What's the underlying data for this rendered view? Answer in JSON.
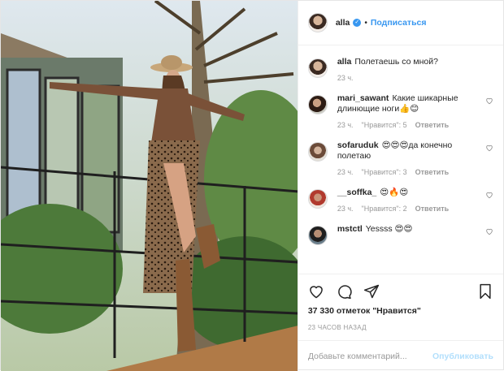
{
  "header": {
    "username": "alla",
    "verified_icon": "verified-check-icon",
    "separator": "•",
    "follow_label": "Подписаться"
  },
  "caption": {
    "username": "alla",
    "text": "Полетаешь со мной?",
    "time": "23 ч."
  },
  "comments": [
    {
      "username": "mari_sawant",
      "text": "Какие шикарные длинющие ноги👍😊",
      "time": "23 ч.",
      "likes": "\"Нравится\": 5",
      "reply": "Ответить"
    },
    {
      "username": "sofaruduk",
      "text": "😍😍😍да конечно полетаю",
      "time": "23 ч.",
      "likes": "\"Нравится\": 3",
      "reply": "Ответить"
    },
    {
      "username": "__soffka_",
      "text": "😍🔥😍",
      "time": "23 ч.",
      "likes": "\"Нравится\": 2",
      "reply": "Ответить"
    },
    {
      "username": "mstctl",
      "text": "Yessss 😍😍",
      "time": "",
      "likes": "",
      "reply": ""
    }
  ],
  "actions": {
    "like_icon": "heart-icon",
    "comment_icon": "comment-icon",
    "share_icon": "share-icon",
    "save_icon": "bookmark-icon"
  },
  "likes_text": "37 330 отметок \"Нравится\"",
  "posted_time": "23 ЧАСОВ НАЗАД",
  "add_comment": {
    "placeholder": "Добавьте комментарий...",
    "publish_label": "Опубликовать"
  },
  "colors": {
    "accent": "#3897f0",
    "publish_disabled": "#b2dffc",
    "muted": "#999999",
    "border": "#efefef"
  }
}
